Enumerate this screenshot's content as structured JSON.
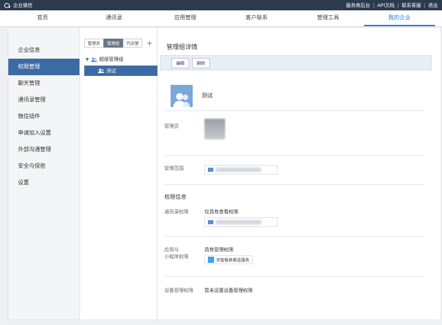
{
  "topbar": {
    "brand": "企业微信",
    "links": [
      "服务商后台",
      "API文档",
      "联系客服",
      "退出"
    ]
  },
  "nav": {
    "items": [
      "首页",
      "通讯录",
      "应用管理",
      "客户联系",
      "管理工具",
      "我的企业"
    ],
    "active_index": 5
  },
  "sidebar": {
    "items": [
      "企业信息",
      "权限管理",
      "聊天管理",
      "通讯录管理",
      "微信插件",
      "申请加入设置",
      "外部沟通管理",
      "安全与保密",
      "设置"
    ],
    "active_index": 1
  },
  "tree": {
    "tabs": [
      "管理员",
      "管理组",
      "代运营"
    ],
    "active_tab": 1,
    "add_label": "+",
    "root_label": "超级管理组",
    "child_label": "测试"
  },
  "detail": {
    "title": "管理组详情",
    "edit_label": "编辑",
    "delete_label": "删除",
    "group_name": "测试",
    "admin_label": "管理员",
    "scope_label": "管理范围",
    "section_title": "权限信息",
    "contacts_perm_label": "通讯录权限",
    "contacts_perm_value": "仅具有查看权限",
    "app_perm_label_1": "应用与",
    "app_perm_label_2": "小程序权限",
    "app_perm_value": "具有管理权限",
    "app_name": "天智报表推送服务",
    "device_perm_label": "设备管理权限",
    "device_perm_value": "暂未设置设备管理权限"
  },
  "colors": {
    "topbar": "#2b3a4e",
    "accent": "#3c6aa4",
    "nav_active": "#2c7be5"
  }
}
